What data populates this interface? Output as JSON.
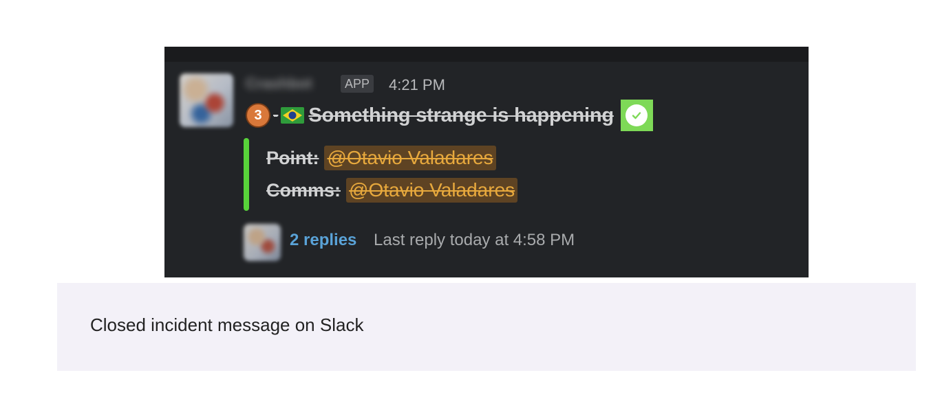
{
  "message": {
    "sender_name": "Crashbot",
    "app_badge": "APP",
    "timestamp": "4:21 PM",
    "incident_count": "3",
    "separator": "-",
    "flag_icon": "brazil-flag-icon",
    "title": "Something strange is happening",
    "status_icon": "check-mark-icon",
    "fields": [
      {
        "label": "Point:",
        "mention": "@Otavio Valadares"
      },
      {
        "label": "Comms:",
        "mention": "@Otavio Valadares"
      }
    ],
    "replies_label": "2 replies",
    "last_reply": "Last reply today at 4:58 PM"
  },
  "caption": {
    "text": "Closed incident message on Slack"
  },
  "colors": {
    "background": "#222427",
    "attachment_bar": "#58d33a",
    "mention_bg": "#5e4323",
    "mention_text": "#e8a93d",
    "link": "#5aa3d8",
    "check_bg": "#7ed957",
    "count_badge": "#d9783a",
    "caption_bg": "#f3f1f8"
  }
}
